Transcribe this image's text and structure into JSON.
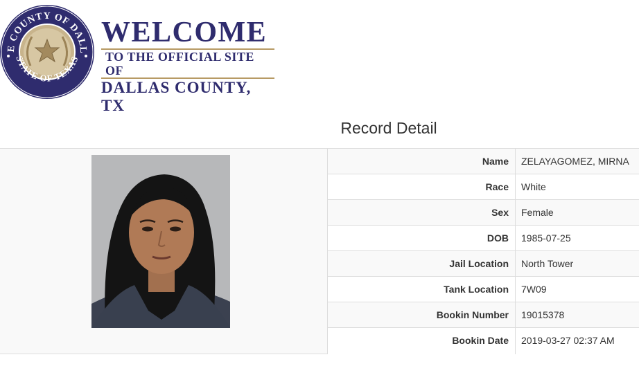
{
  "header": {
    "seal_text_top": "THE COUNTY OF DALLAS",
    "seal_text_bottom": "STATE OF TEXAS",
    "welcome_title": "WELCOME",
    "welcome_subtitle": "TO THE OFFICIAL SITE OF",
    "welcome_county": "DALLAS COUNTY, TX",
    "colors": {
      "navy": "#2f2c6e",
      "gold": "#b79a64"
    }
  },
  "page_title": "Record Detail",
  "record": {
    "photo": {
      "icon": "mugshot-photo"
    },
    "fields": [
      {
        "label": "Name",
        "value": "ZELAYAGOMEZ, MIRNA"
      },
      {
        "label": "Race",
        "value": "White"
      },
      {
        "label": "Sex",
        "value": "Female"
      },
      {
        "label": "DOB",
        "value": "1985-07-25"
      },
      {
        "label": "Jail Location",
        "value": "North Tower"
      },
      {
        "label": "Tank Location",
        "value": "7W09"
      },
      {
        "label": "Bookin Number",
        "value": "19015378"
      },
      {
        "label": "Bookin Date",
        "value": "2019-03-27 02:37 AM"
      }
    ]
  }
}
